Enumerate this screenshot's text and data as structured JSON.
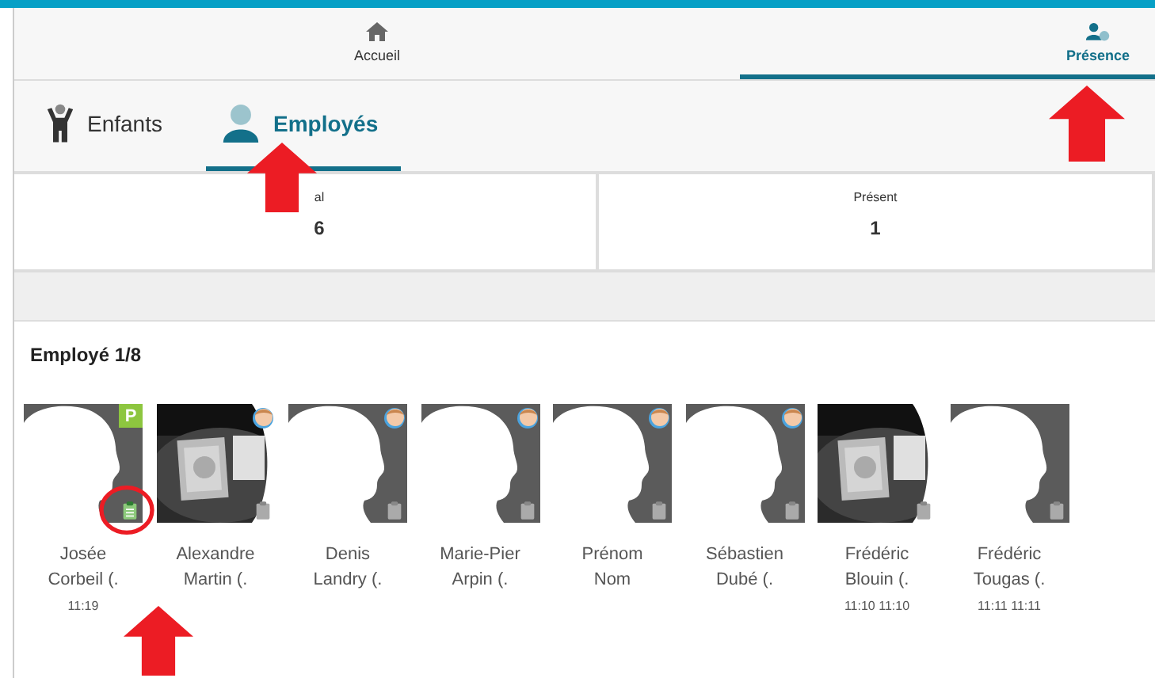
{
  "nav": [
    {
      "label": "Accueil",
      "kind": "home",
      "selected": false
    },
    {
      "label": "Présence",
      "kind": "presence",
      "selected": true
    }
  ],
  "tabs": [
    {
      "label": "Enfants",
      "kind": "child",
      "selected": false
    },
    {
      "label": "Employés",
      "kind": "person",
      "selected": true
    }
  ],
  "stats": [
    {
      "label": "al",
      "value": "6"
    },
    {
      "label": "Présent",
      "value": "1"
    }
  ],
  "card": {
    "title": "Employé 1/8",
    "employees": [
      {
        "first": "Josée",
        "last": "Corbeil (.",
        "times": "11:19",
        "kind": "silhouette",
        "present": true,
        "badge_text": "P",
        "child_badge": false,
        "note": true
      },
      {
        "first": "Alexandre",
        "last": "Martin (.",
        "kind": "picture",
        "present": false,
        "child_badge": true,
        "note": false
      },
      {
        "first": "Denis",
        "last": "Landry (.",
        "kind": "silhouette",
        "present": false,
        "child_badge": true,
        "note": false
      },
      {
        "first": "Marie-Pier",
        "last": "Arpin (.",
        "kind": "silhouette",
        "present": false,
        "child_badge": true,
        "note": false
      },
      {
        "first": "Prénom",
        "last": "Nom",
        "kind": "silhouette",
        "present": false,
        "child_badge": true,
        "note": false
      },
      {
        "first": "Sébastien",
        "last": "Dubé (.",
        "kind": "silhouette",
        "present": false,
        "child_badge": true,
        "note": false
      },
      {
        "first": "Frédéric",
        "last": "Blouin (.",
        "times": "11:10 11:10",
        "kind": "picture",
        "present": false,
        "child_badge": false,
        "note": false
      },
      {
        "first": "Frédéric",
        "last": "Tougas (.",
        "times": "11:11 11:11",
        "kind": "silhouette",
        "present": false,
        "child_badge": false,
        "note": false
      }
    ]
  }
}
